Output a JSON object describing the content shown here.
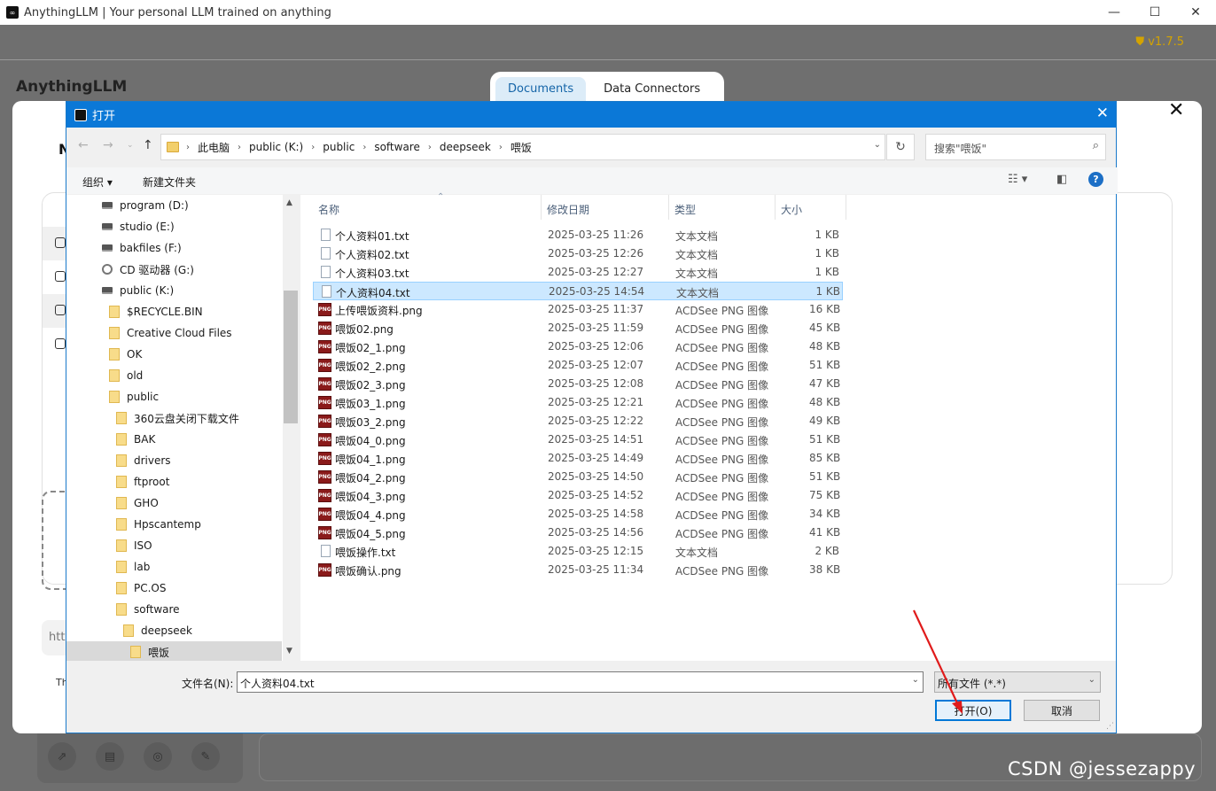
{
  "app": {
    "title": "AnythingLLM | Your personal LLM trained on anything",
    "version": "v1.7.5",
    "logo_text": "AnythingLLM",
    "logo_letter": "N",
    "th_text": "Th",
    "url_prefix": "htt"
  },
  "modal": {
    "tabs": [
      {
        "label": "Documents",
        "active": true
      },
      {
        "label": "Data Connectors",
        "active": false
      }
    ]
  },
  "dialog": {
    "title": "打开",
    "breadcrumb": [
      "此电脑",
      "public (K:)",
      "public",
      "software",
      "deepseek",
      "喂饭"
    ],
    "search_placeholder": "搜索\"喂饭\"",
    "toolbar": {
      "organize": "组织 ▾",
      "new_folder": "新建文件夹"
    },
    "tree": [
      {
        "label": "program (D:)",
        "type": "drive",
        "indent": 0
      },
      {
        "label": "studio (E:)",
        "type": "drive",
        "indent": 0
      },
      {
        "label": "bakfiles (F:)",
        "type": "drive",
        "indent": 0
      },
      {
        "label": "CD 驱动器 (G:)",
        "type": "cd",
        "indent": 0
      },
      {
        "label": "public (K:)",
        "type": "drive",
        "indent": 0
      },
      {
        "label": "$RECYCLE.BIN",
        "type": "folder",
        "indent": 1
      },
      {
        "label": "Creative Cloud Files",
        "type": "folder",
        "indent": 1
      },
      {
        "label": "OK",
        "type": "folder",
        "indent": 1
      },
      {
        "label": "old",
        "type": "folder",
        "indent": 1
      },
      {
        "label": "public",
        "type": "folder",
        "indent": 1
      },
      {
        "label": "360云盘关闭下载文件",
        "type": "folder",
        "indent": 2
      },
      {
        "label": "BAK",
        "type": "folder",
        "indent": 2
      },
      {
        "label": "drivers",
        "type": "folder",
        "indent": 2
      },
      {
        "label": "ftproot",
        "type": "folder",
        "indent": 2
      },
      {
        "label": "GHO",
        "type": "folder",
        "indent": 2
      },
      {
        "label": "Hpscantemp",
        "type": "folder",
        "indent": 2
      },
      {
        "label": "ISO",
        "type": "folder",
        "indent": 2
      },
      {
        "label": "lab",
        "type": "folder",
        "indent": 2
      },
      {
        "label": "PC.OS",
        "type": "folder",
        "indent": 2
      },
      {
        "label": "software",
        "type": "folder",
        "indent": 2
      },
      {
        "label": "deepseek",
        "type": "folder",
        "indent": 3
      },
      {
        "label": "喂饭",
        "type": "folder",
        "indent": 4,
        "selected": true
      }
    ],
    "columns": [
      "名称",
      "修改日期",
      "类型",
      "大小"
    ],
    "files": [
      {
        "name": "个人资料01.txt",
        "date": "2025-03-25 11:26",
        "type": "文本文档",
        "size": "1 KB",
        "icon": "txt"
      },
      {
        "name": "个人资料02.txt",
        "date": "2025-03-25 12:26",
        "type": "文本文档",
        "size": "1 KB",
        "icon": "txt"
      },
      {
        "name": "个人资料03.txt",
        "date": "2025-03-25 12:27",
        "type": "文本文档",
        "size": "1 KB",
        "icon": "txt"
      },
      {
        "name": "个人资料04.txt",
        "date": "2025-03-25 14:54",
        "type": "文本文档",
        "size": "1 KB",
        "icon": "txt",
        "selected": true
      },
      {
        "name": "上传喂饭资料.png",
        "date": "2025-03-25 11:37",
        "type": "ACDSee PNG 图像",
        "size": "16 KB",
        "icon": "png"
      },
      {
        "name": "喂饭02.png",
        "date": "2025-03-25 11:59",
        "type": "ACDSee PNG 图像",
        "size": "45 KB",
        "icon": "png"
      },
      {
        "name": "喂饭02_1.png",
        "date": "2025-03-25 12:06",
        "type": "ACDSee PNG 图像",
        "size": "48 KB",
        "icon": "png"
      },
      {
        "name": "喂饭02_2.png",
        "date": "2025-03-25 12:07",
        "type": "ACDSee PNG 图像",
        "size": "51 KB",
        "icon": "png"
      },
      {
        "name": "喂饭02_3.png",
        "date": "2025-03-25 12:08",
        "type": "ACDSee PNG 图像",
        "size": "47 KB",
        "icon": "png"
      },
      {
        "name": "喂饭03_1.png",
        "date": "2025-03-25 12:21",
        "type": "ACDSee PNG 图像",
        "size": "48 KB",
        "icon": "png"
      },
      {
        "name": "喂饭03_2.png",
        "date": "2025-03-25 12:22",
        "type": "ACDSee PNG 图像",
        "size": "49 KB",
        "icon": "png"
      },
      {
        "name": "喂饭04_0.png",
        "date": "2025-03-25 14:51",
        "type": "ACDSee PNG 图像",
        "size": "51 KB",
        "icon": "png"
      },
      {
        "name": "喂饭04_1.png",
        "date": "2025-03-25 14:49",
        "type": "ACDSee PNG 图像",
        "size": "85 KB",
        "icon": "png"
      },
      {
        "name": "喂饭04_2.png",
        "date": "2025-03-25 14:50",
        "type": "ACDSee PNG 图像",
        "size": "51 KB",
        "icon": "png"
      },
      {
        "name": "喂饭04_3.png",
        "date": "2025-03-25 14:52",
        "type": "ACDSee PNG 图像",
        "size": "75 KB",
        "icon": "png"
      },
      {
        "name": "喂饭04_4.png",
        "date": "2025-03-25 14:58",
        "type": "ACDSee PNG 图像",
        "size": "34 KB",
        "icon": "png"
      },
      {
        "name": "喂饭04_5.png",
        "date": "2025-03-25 14:56",
        "type": "ACDSee PNG 图像",
        "size": "41 KB",
        "icon": "png"
      },
      {
        "name": "喂饭操作.txt",
        "date": "2025-03-25 12:15",
        "type": "文本文档",
        "size": "2 KB",
        "icon": "txt"
      },
      {
        "name": "喂饭确认.png",
        "date": "2025-03-25 11:34",
        "type": "ACDSee PNG 图像",
        "size": "38 KB",
        "icon": "png"
      }
    ],
    "filename_label": "文件名(N):",
    "filename_value": "个人资料04.txt",
    "filetype_value": "所有文件 (*.*)",
    "open_button": "打开(O)",
    "cancel_button": "取消"
  },
  "watermark": "CSDN @jessezappy",
  "colors": {
    "dialog_title_bar": "#0b78d7",
    "selection": "#cce8ff",
    "version": "#d4a300",
    "arrow": "#e01b1b"
  }
}
